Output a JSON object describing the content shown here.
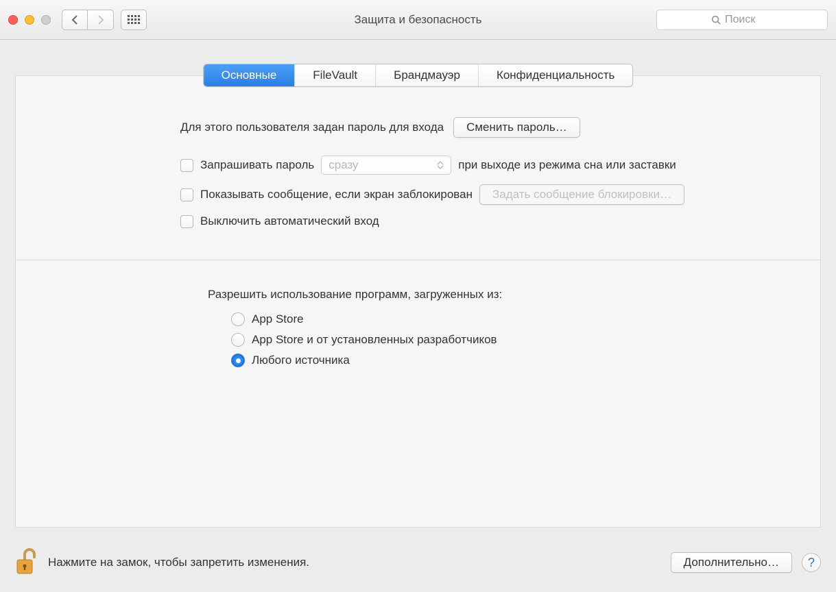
{
  "window": {
    "title": "Защита и безопасность"
  },
  "search": {
    "placeholder": "Поиск"
  },
  "tabs": [
    {
      "label": "Основные",
      "active": true
    },
    {
      "label": "FileVault",
      "active": false
    },
    {
      "label": "Брандмауэр",
      "active": false
    },
    {
      "label": "Конфиденциальность",
      "active": false
    }
  ],
  "general": {
    "password_set_label": "Для этого пользователя задан пароль для входа",
    "change_password_button": "Сменить пароль…",
    "require_password_label": "Запрашивать пароль",
    "require_password_delay": "сразу",
    "require_password_suffix": "при выходе из режима сна или заставки",
    "show_message_label": "Показывать сообщение, если экран заблокирован",
    "set_lock_message_button": "Задать сообщение блокировки…",
    "disable_auto_login_label": "Выключить автоматический вход"
  },
  "allow_apps": {
    "heading": "Разрешить использование программ, загруженных из:",
    "options": [
      {
        "label": "App Store",
        "checked": false
      },
      {
        "label": "App Store и от установленных разработчиков",
        "checked": false
      },
      {
        "label": "Любого источника",
        "checked": true
      }
    ]
  },
  "footer": {
    "lock_text": "Нажмите на замок, чтобы запретить изменения.",
    "advanced_button": "Дополнительно…",
    "help": "?"
  }
}
